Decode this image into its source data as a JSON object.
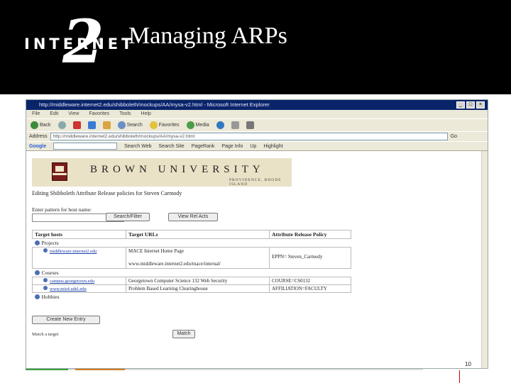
{
  "slide": {
    "logo_word": "INTERNET",
    "logo_numeral": "2",
    "logo_reg": "®",
    "title": "Managing ARPs",
    "page_number": "10"
  },
  "browser": {
    "title": "http://middleware.internet2.edu/shibboleth/mockups/AA/mysa-v2.html - Microsoft Internet Explorer",
    "menu": [
      "File",
      "Edit",
      "View",
      "Favorites",
      "Tools",
      "Help"
    ],
    "toolbar": [
      "Back",
      "Search",
      "Favorites",
      "Media"
    ],
    "address_label": "Address",
    "address": "http://middleware.internet2.edu/shibboleth/mockups/AA/mysa-v2.html",
    "go_label": "Go",
    "google_label": "Google",
    "google_items": [
      "Search Web",
      "Search Site",
      "PageRank",
      "Page Info",
      "Up",
      "Highlight"
    ]
  },
  "page": {
    "banner_name": "BROWN UNIVERSITY",
    "banner_sub": "PROVIDENCE, RHODE ISLAND",
    "heading": "Editing Shibboleth Attribute Release policies for Steven Carmody",
    "pattern_label": "Enter pattern for host name:",
    "search_button": "Search/Filter",
    "view_button": "View Rel Acts",
    "table": {
      "headers": [
        "Target hosts",
        "Target URLs",
        "Attribute Release Policy"
      ],
      "groups": [
        {
          "name": "Projects",
          "rows": [
            {
              "host": "middleware.internet2.edu",
              "urls": [
                "MACE Internet Home Page",
                "www.middleware.internet2.edu/mace/internal/"
              ],
              "policy": "EPPN= Steven_Carmody"
            }
          ]
        },
        {
          "name": "Courses",
          "rows": [
            {
              "host": "campus.georgetown.edu",
              "urls": [
                "Georgetown Computer Science 132 Web Security"
              ],
              "policy": "COURSE=CS0132"
            },
            {
              "host": "www.mis4.udel.edu",
              "urls": [
                "Problem Based Learning Clearinghouse"
              ],
              "policy": "AFFILIATION=FACULTY"
            }
          ]
        },
        {
          "name": "Hobbies",
          "rows": []
        }
      ]
    },
    "create_button": "Create New Entry",
    "match_label": "Match a target",
    "match_button": "Match"
  }
}
